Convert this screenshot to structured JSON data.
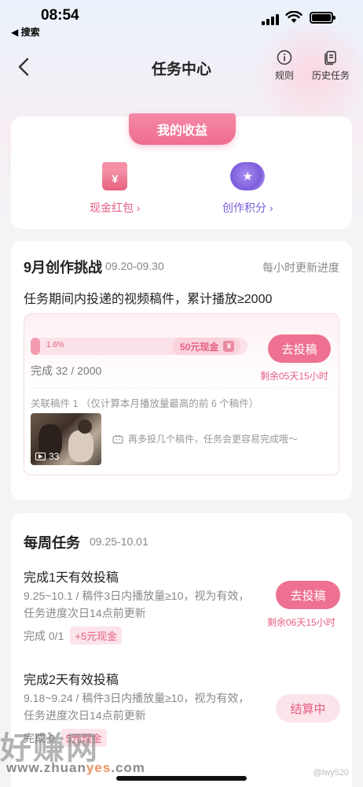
{
  "status_bar": {
    "time": "08:54",
    "back_app": "◀ 搜索"
  },
  "nav": {
    "title": "任务中心",
    "rules_label": "规则",
    "history_label": "历史任务"
  },
  "earnings": {
    "tab_label": "我的收益",
    "items": [
      {
        "label": "现金红包 ›",
        "icon": "red-packet-icon",
        "color": "#e65f82"
      },
      {
        "label": "创作积分 ›",
        "icon": "star-badge-icon",
        "color": "#7b5ddc"
      }
    ]
  },
  "challenge": {
    "title": "9月创作挑战",
    "dates": "09.20-09.30",
    "update_note": "每小时更新进度",
    "description": "任务期间内投递的视频稿件，累计播放≥2000",
    "progress_percent_label": "1.6%",
    "progress_fraction": 0.016,
    "reward_label": "50元现金",
    "reward_icon": "¥",
    "completion": "完成 32 / 2000",
    "submit_label": "去投稿",
    "remaining": "剩余05天15小时",
    "related_note": "关联稿件 1 （仅计算本月播放量最高的前 6 个稿件）",
    "video_plays": "33",
    "hint": "再多投几个稿件，任务会更容易完成哦～"
  },
  "weekly": {
    "title": "每周任务",
    "dates": "09.25-10.01",
    "tasks": [
      {
        "title": "完成1天有效投稿",
        "desc": "9.25~10.1 / 稿件3日内播放量≥10，视为有效，任务进度次日14点前更新",
        "status": "完成 0/1",
        "reward": "+5元现金",
        "button": "去投稿",
        "remaining": "剩余06天15小时"
      },
      {
        "title": "完成2天有效投稿",
        "desc": "9.18~9.24 / 稿件3日内播放量≥10，视为有效，任务进度次日14点前更新",
        "status": "完成 0",
        "reward": "5元现金",
        "button": "结算中"
      }
    ]
  },
  "watermark": {
    "brand": "好赚网",
    "url_prefix": "www.zhuan",
    "url_highlight": "yes",
    "url_suffix": ".com",
    "right": "@lwy520"
  },
  "colors": {
    "accent": "#ee7191",
    "accent_text": "#e65f82",
    "purple": "#7b5ddc"
  }
}
